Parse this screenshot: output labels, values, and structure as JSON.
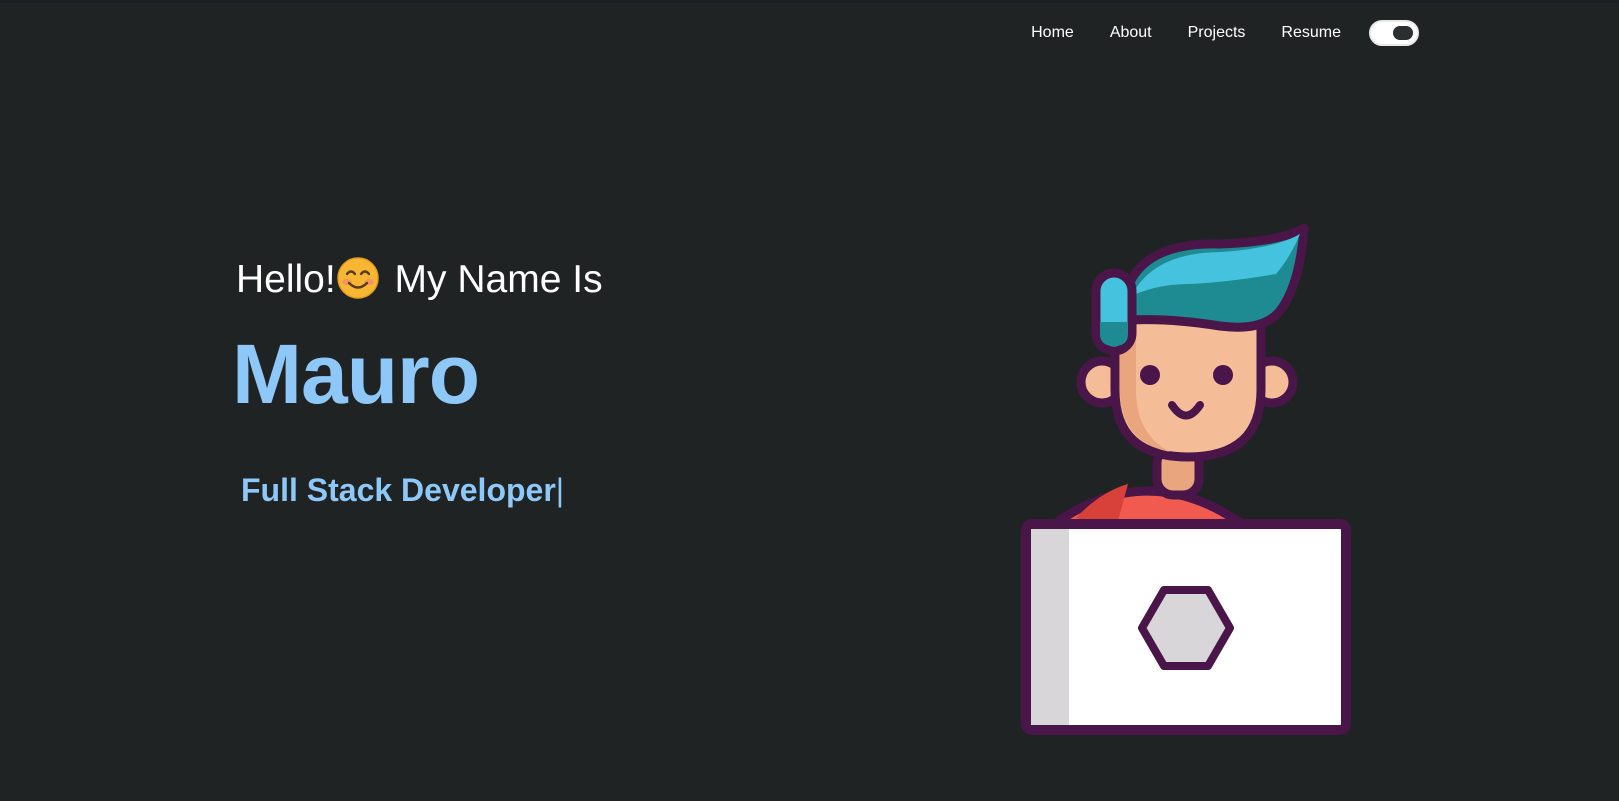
{
  "nav": {
    "items": [
      {
        "label": "Home"
      },
      {
        "label": "About"
      },
      {
        "label": "Projects"
      },
      {
        "label": "Resume"
      }
    ],
    "theme_toggle": {
      "state": "dark"
    }
  },
  "hero": {
    "greeting_before": "Hello!",
    "greeting_emoji": "smiling-face-emoji",
    "greeting_after": " My Name Is",
    "name": "Mauro",
    "role": "Full Stack Developer",
    "cursor": "|"
  },
  "colors": {
    "background": "#202323",
    "accent": "#8dc8f8",
    "text": "#ffffff"
  }
}
